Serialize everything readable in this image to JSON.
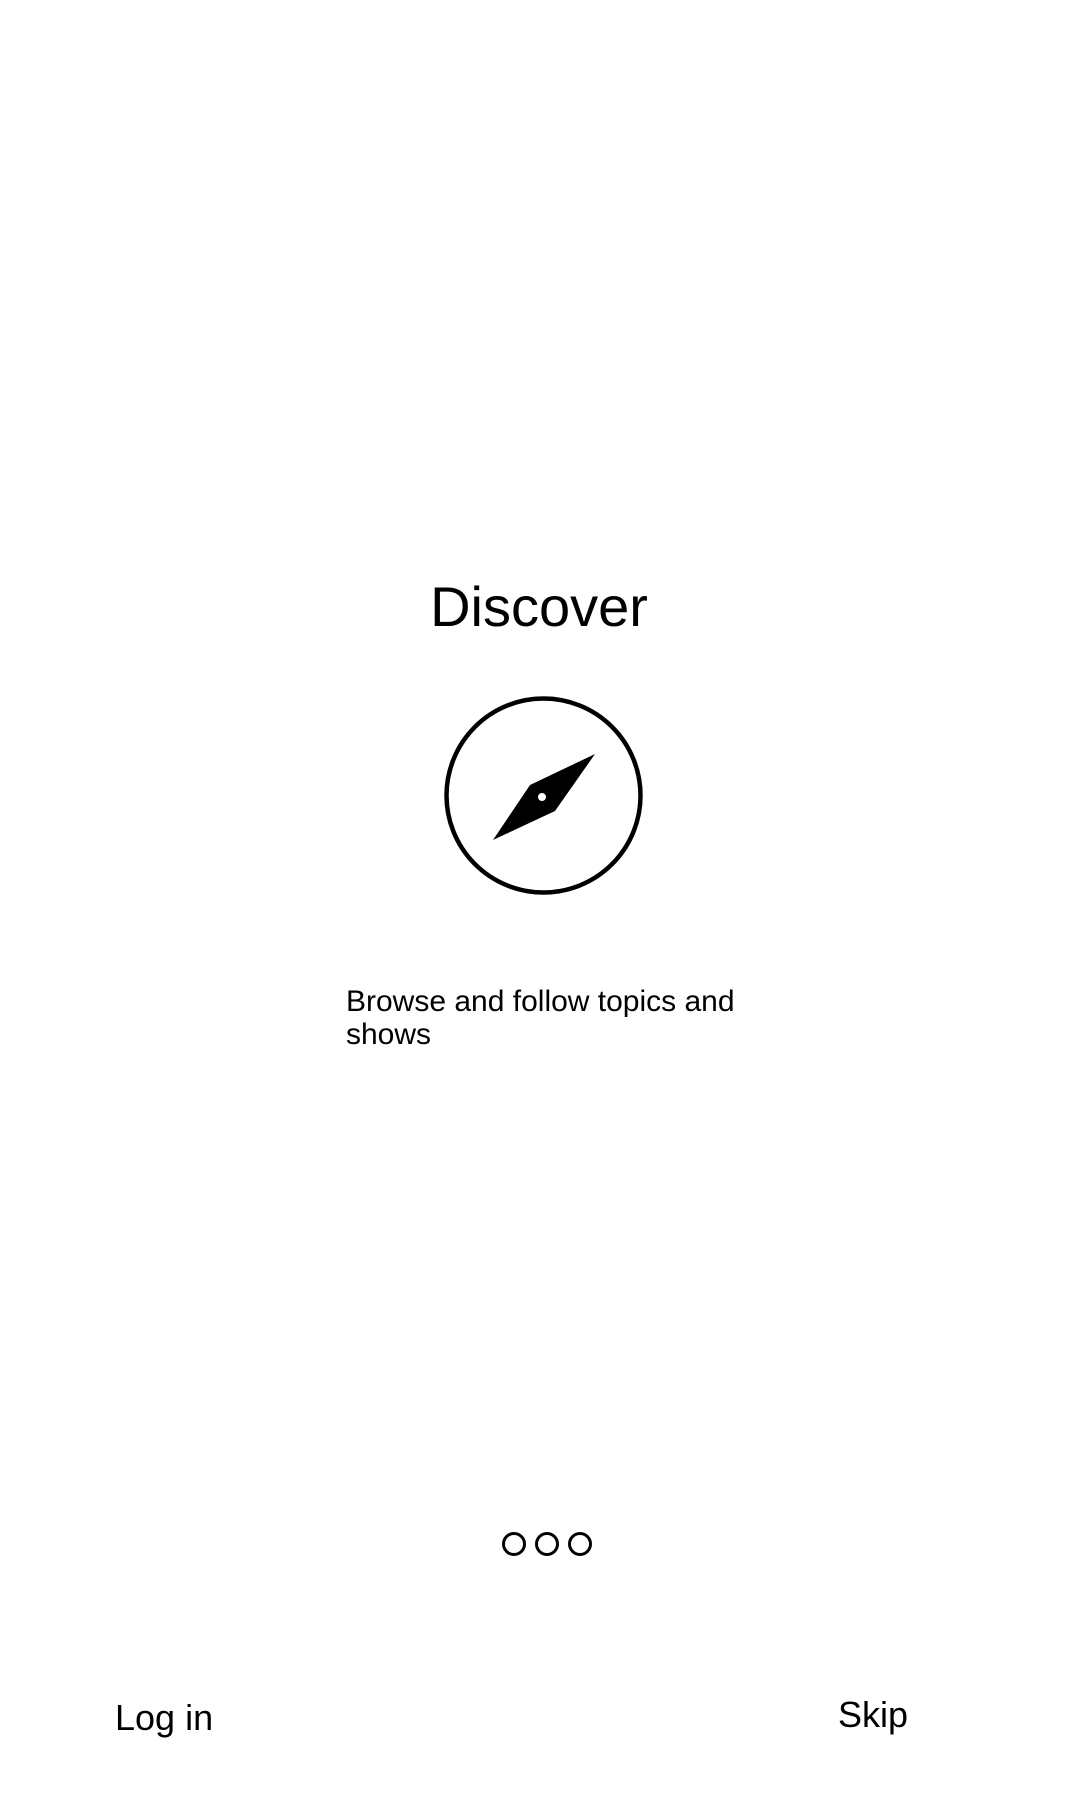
{
  "onboarding": {
    "title": "Discover",
    "icon": "compass-icon",
    "subtitle": "Browse and follow topics and shows",
    "page_indicator": {
      "pages": 3
    }
  },
  "footer": {
    "login_label": "Log in",
    "skip_label": "Skip"
  },
  "colors": {
    "background": "#ffffff",
    "foreground": "#000000"
  }
}
